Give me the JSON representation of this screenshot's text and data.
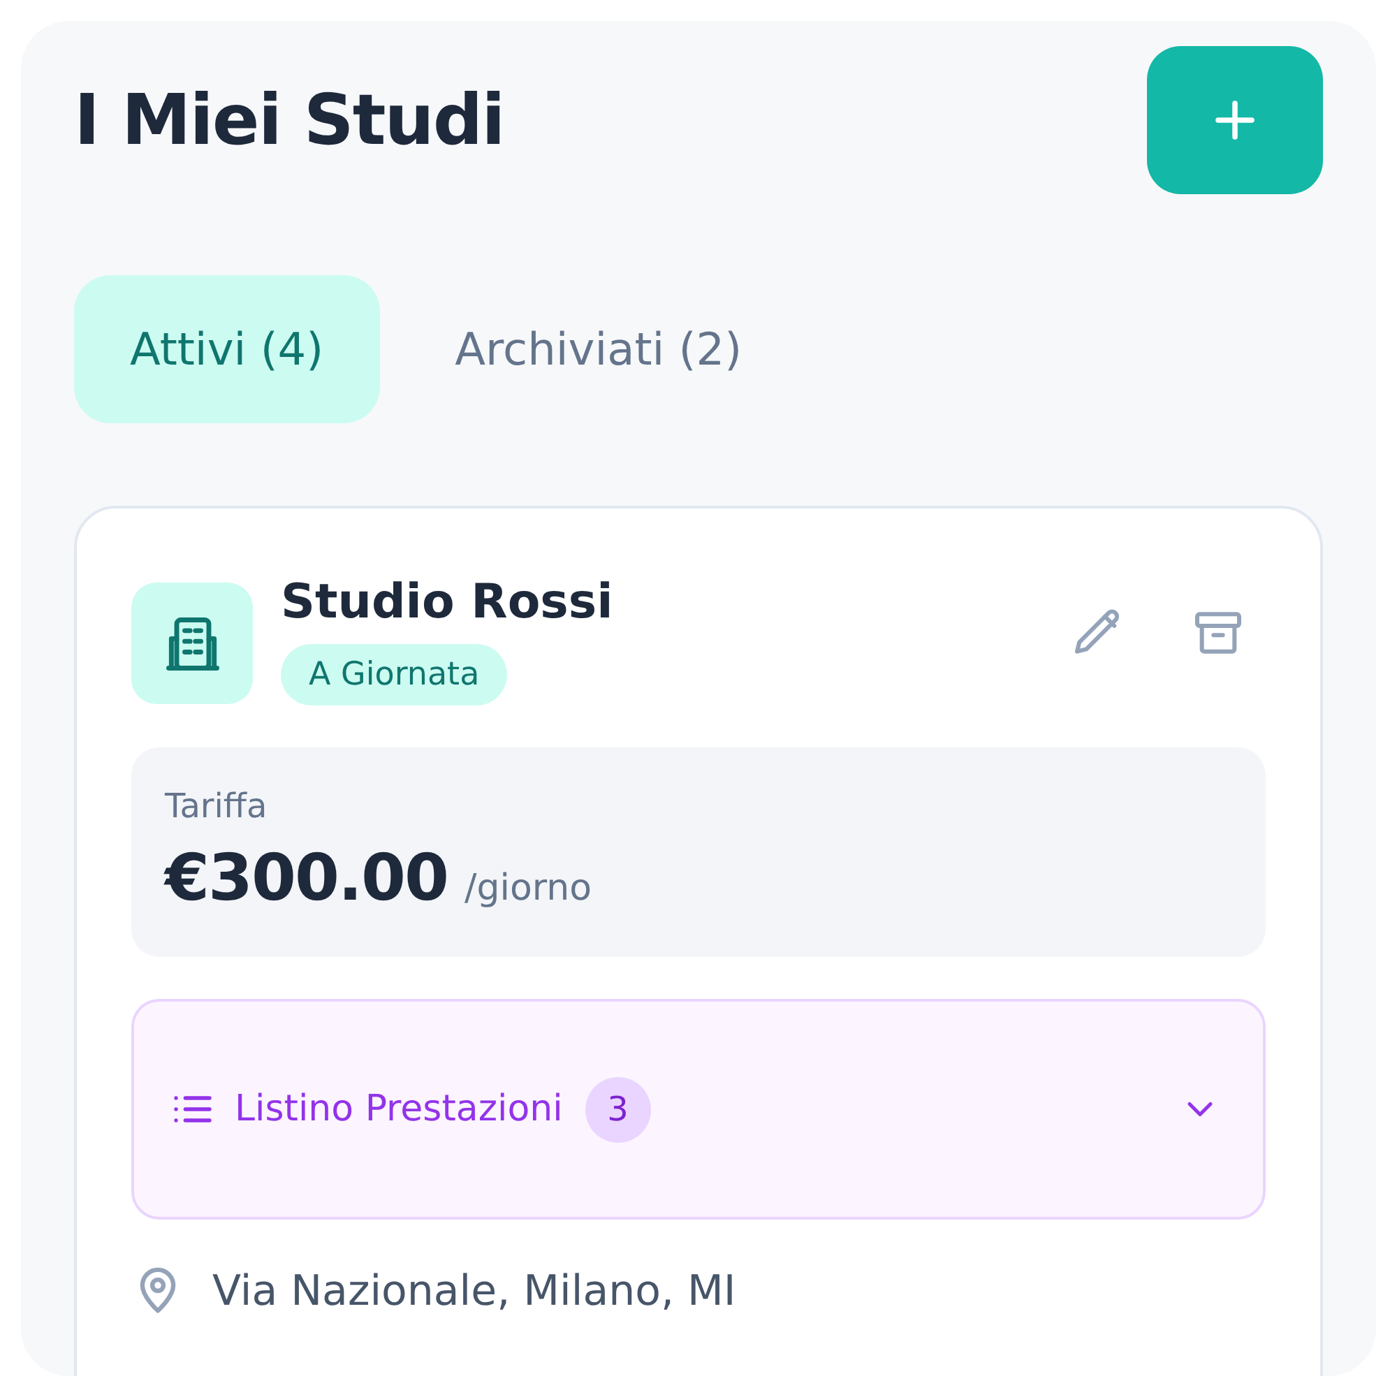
{
  "title": "I Miei Studi",
  "tabs": [
    {
      "label": "Attivi (4)",
      "selected": true
    },
    {
      "label": "Archiviati (2)",
      "selected": false
    }
  ],
  "studios": [
    {
      "name": "Studio Rossi",
      "badge": "A Giornata",
      "rate_label": "Tariffa",
      "rate": "€300.00",
      "rate_unit": "/giorno",
      "services": {
        "label": "Listino Prestazioni",
        "count": "3",
        "expanded": false
      },
      "address": "Via Nazionale, Milano, MI"
    }
  ]
}
